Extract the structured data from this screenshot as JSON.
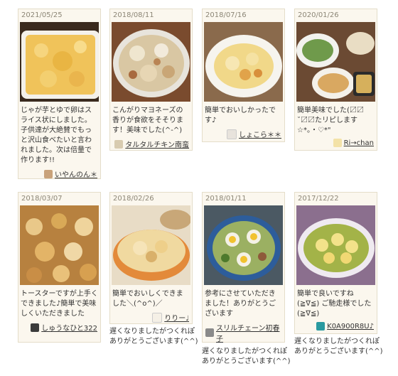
{
  "cards": [
    {
      "date": "2021/05/25",
      "comment": "じゃが芋とゆで卵はスライス状にしました。子供達が大絶賛でもっと沢山食べたいと言われました。次は倍量で作ります!!",
      "user": "いやんのん＊",
      "avatar_color": "#c9a27a"
    },
    {
      "date": "2018/08/11",
      "comment": "こんがりマヨネーズの香りが食欲をそそります！美味でした(^-^)",
      "user": "タルタルチキン南蛮",
      "avatar_color": "#d8cbb0"
    },
    {
      "date": "2018/07/16",
      "comment": "簡単でおいしかったです♪",
      "user": "しょこら＊＊",
      "avatar_color": "#e8e3dc"
    },
    {
      "date": "2020/01/26",
      "comment": "簡単美味でした(〼〼 ˘〼〼たリピします☆*。・♡*\"",
      "user": "Ri→chan",
      "avatar_color": "#f3e2a8"
    },
    {
      "date": "2018/03/07",
      "comment": "トースターですが上手くできました♪簡単で美味しくいただきました",
      "user": "しゅうなひと322",
      "avatar_color": "#3b3b3b"
    },
    {
      "date": "2018/02/26",
      "comment": "簡単でおいしくできました＼(^o^)／",
      "user": "りりー♩",
      "avatar_color": "#f5f0e6"
    },
    {
      "date": "2018/01/11",
      "comment": "参考にさせていただきました！ありがとうございます",
      "user": "スリルチェーン初春子",
      "avatar_color": "#8a8a8a"
    },
    {
      "date": "2017/12/22",
      "comment": "簡単で良いですね (≧∇≦) ご馳走様でした(≧∇≦)",
      "user": "K0A900R8U♪",
      "avatar_color": "#2a9aa0"
    }
  ],
  "replies": [
    "遅くなりましたがつくれぽありがとうございます(^^)",
    "遅くなりましたがつくれぽありがとうございます(^^)",
    "遅くなりましたがつくれぽありがとうございます(^^)"
  ]
}
